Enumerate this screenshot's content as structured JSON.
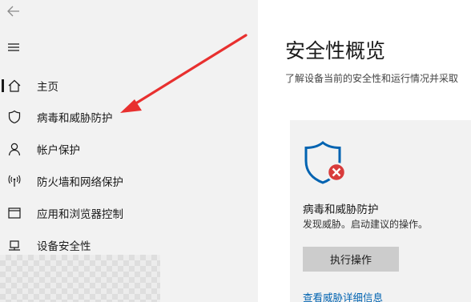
{
  "window": {
    "back_icon": "back-arrow-icon",
    "menu_icon": "hamburger-menu-icon"
  },
  "sidebar": {
    "items": [
      {
        "label": "主页",
        "icon": "home-icon",
        "active": true
      },
      {
        "label": "病毒和威胁防护",
        "icon": "shield-icon",
        "active": false
      },
      {
        "label": "帐户保护",
        "icon": "person-icon",
        "active": false
      },
      {
        "label": "防火墙和网络保护",
        "icon": "wireless-icon",
        "active": false
      },
      {
        "label": "应用和浏览器控制",
        "icon": "app-window-icon",
        "active": false
      },
      {
        "label": "设备安全性",
        "icon": "device-icon",
        "active": false
      }
    ]
  },
  "main": {
    "title": "安全性概览",
    "subtitle": "了解设备当前的安全性和运行情况并采取",
    "card": {
      "icon": "shield-error-icon",
      "title": "病毒和威胁防护",
      "description": "发现威胁。启动建议的操作。",
      "action_label": "执行操作",
      "link_label": "查看威胁详细信息"
    }
  },
  "colors": {
    "sidebar_bg": "#f2f2f2",
    "accent_blue": "#0063b1",
    "error_red": "#d83b3b",
    "annotation_red": "#e8302f",
    "button_bg": "#cccccc"
  }
}
